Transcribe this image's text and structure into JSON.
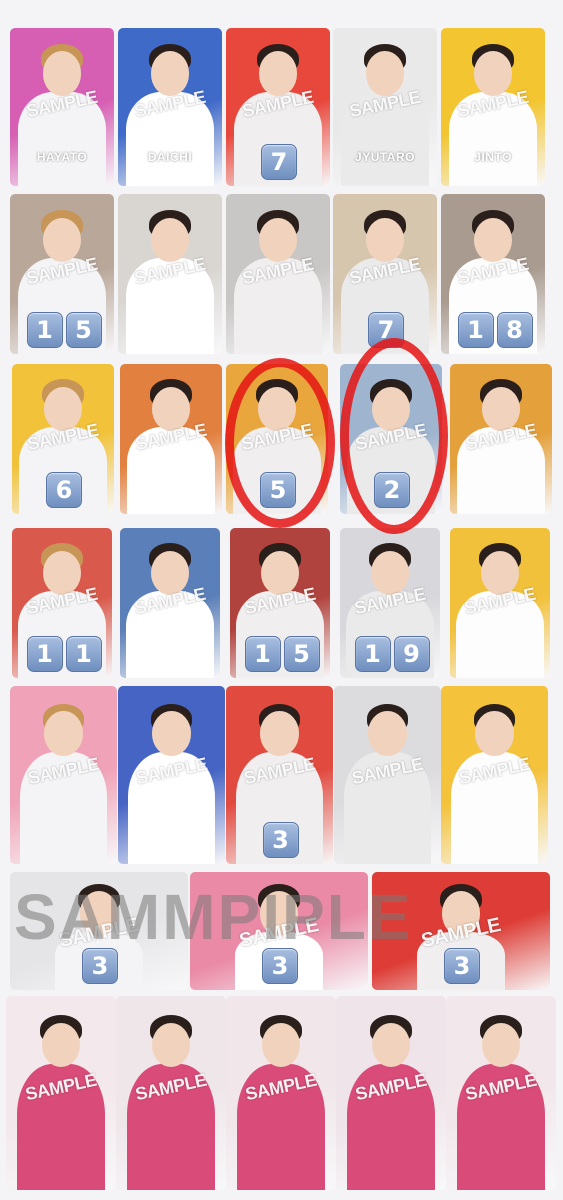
{
  "watermark": "SAMPLE",
  "row_watermark_large": "SAMMPIPLE",
  "rows": [
    {
      "cards": [
        {
          "name": "HAYATO",
          "bg": "#d65fb3",
          "badges": []
        },
        {
          "name": "DAICHI",
          "bg": "#3f6ac8",
          "badges": []
        },
        {
          "name": "",
          "bg": "#e8473c",
          "badges": [
            "7"
          ]
        },
        {
          "name": "JYUTARO",
          "bg": "#e9e9ea",
          "badges": []
        },
        {
          "name": "JINTO",
          "bg": "#f2c531",
          "badges": []
        }
      ]
    },
    {
      "cards": [
        {
          "bg": "#b9a79a",
          "badges": [
            "1",
            "5"
          ]
        },
        {
          "bg": "#d9d6d2",
          "badges": []
        },
        {
          "bg": "#c9c7c5",
          "badges": []
        },
        {
          "bg": "#d7c6ae",
          "badges": [
            "7"
          ]
        },
        {
          "bg": "#a99b90",
          "badges": [
            "1",
            "8"
          ]
        }
      ]
    },
    {
      "cards": [
        {
          "bg": "#f1c23a",
          "badges": [
            "6"
          ]
        },
        {
          "bg": "#e2803f",
          "badges": []
        },
        {
          "bg": "#e8a63c",
          "badges": [
            "5"
          ]
        },
        {
          "bg": "#9fb4cf",
          "badges": [
            "2"
          ]
        },
        {
          "bg": "#e4a03a",
          "badges": []
        }
      ]
    },
    {
      "cards": [
        {
          "bg": "#d9594c",
          "badges": [
            "1",
            "1"
          ]
        },
        {
          "bg": "#5b7fb8",
          "badges": []
        },
        {
          "bg": "#b0433e",
          "badges": [
            "1",
            "5"
          ]
        },
        {
          "bg": "#d8d8dc",
          "badges": [
            "1",
            "9"
          ]
        },
        {
          "bg": "#f2c13b",
          "badges": []
        }
      ]
    },
    {
      "cards": [
        {
          "bg": "#f0a3b8",
          "badges": []
        },
        {
          "bg": "#4564c4",
          "badges": []
        },
        {
          "bg": "#e14a3f",
          "badges": [
            "3"
          ]
        },
        {
          "bg": "#dcdcde",
          "badges": []
        },
        {
          "bg": "#f4c23b",
          "badges": []
        }
      ]
    },
    {
      "cards": [
        {
          "bg": "#e5e5e7",
          "badges": [
            "3"
          ]
        },
        {
          "bg": "#ea8aa6",
          "badges": [
            "3"
          ]
        },
        {
          "bg": "#dd3d36",
          "badges": [
            "3"
          ]
        }
      ]
    },
    {
      "cards": [
        {
          "bg": "#f3e8ec",
          "badges": []
        },
        {
          "bg": "#efe6ea",
          "badges": []
        },
        {
          "bg": "#f1e7eb",
          "badges": []
        },
        {
          "bg": "#efe4e9",
          "badges": []
        },
        {
          "bg": "#f2e8ec",
          "badges": []
        }
      ]
    }
  ],
  "colors": {
    "badge": "#7b97c6",
    "circle": "#e51414"
  }
}
